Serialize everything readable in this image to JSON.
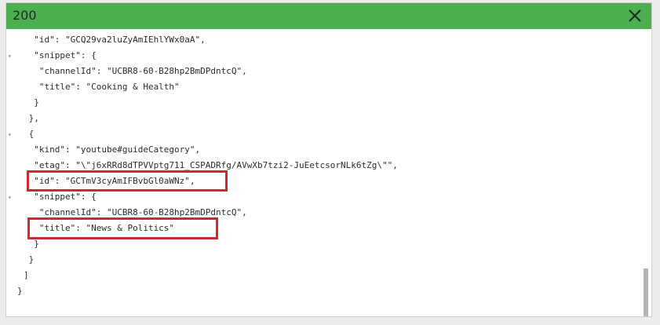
{
  "header": {
    "title": "200",
    "close_icon": "close-icon"
  },
  "code_lines": [
    "  \"id\": \"GCQ29va2luZyAmIEhlYWx0aA\",",
    "  \"snippet\": {",
    "   \"channelId\": \"UCBR8-60-B28hp2BmDPdntcQ\",",
    "   \"title\": \"Cooking & Health\"",
    "  }",
    " },",
    " {",
    "  \"kind\": \"youtube#guideCategory\",",
    "  \"etag\": \"\\\"j6xRRd8dTPVVptg711_CSPADRfg/AVwXb7tzi2-JuEetcsorNLk6tZg\\\"\",",
    "  \"id\": \"GCTmV3cyAmIFBvbGl0aWNz\",",
    "  \"snippet\": {",
    "   \"channelId\": \"UCBR8-60-B28hp2BmDPdntcQ\",",
    "   \"title\": \"News & Politics\"",
    "  }",
    " }",
    "]",
    "}"
  ],
  "highlight_color": "#d0282e",
  "header_color": "#4caf50"
}
